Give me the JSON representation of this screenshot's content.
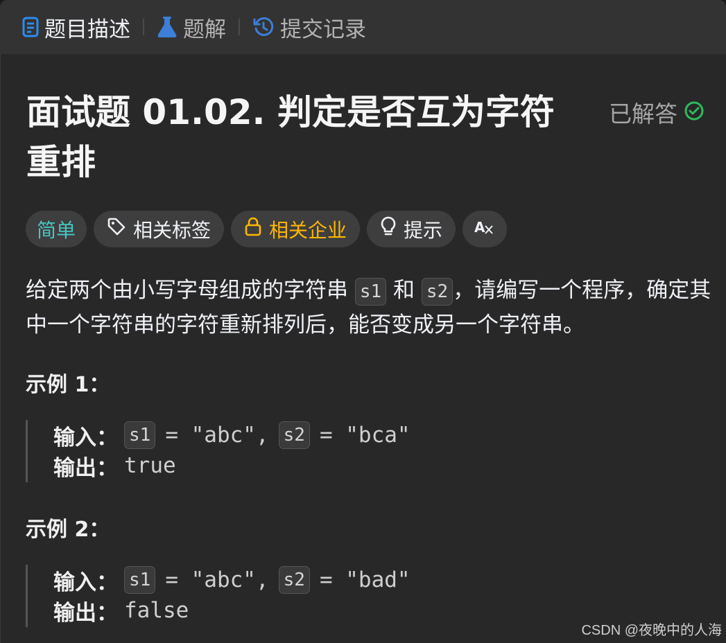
{
  "tabs": [
    {
      "label": "题目描述",
      "icon": "document-icon",
      "active": true
    },
    {
      "label": "题解",
      "icon": "flask-icon",
      "active": false
    },
    {
      "label": "提交记录",
      "icon": "history-icon",
      "active": false
    }
  ],
  "problem": {
    "title": "面试题 01.02. 判定是否互为字符重排",
    "status": "已解答",
    "status_icon": "check-circle-icon"
  },
  "tags": {
    "difficulty": "简单",
    "topics": "相关标签",
    "companies": "相关企业",
    "hint": "提示",
    "font_toggle": "Aあ"
  },
  "description": {
    "part1": "给定两个由小写字母组成的字符串",
    "var1": "s1",
    "part2": "和",
    "var2": "s2",
    "part3": "，请编写一个程序，确定其中一个字符串的字符重新排列后，能否变成另一个字符串。"
  },
  "examples": [
    {
      "title": "示例 1：",
      "input_label": "输入：",
      "var1": "s1",
      "val1": "= \"abc\",",
      "var2": "s2",
      "val2": "= \"bca\"",
      "output_label": "输出：",
      "output": "true"
    },
    {
      "title": "示例 2：",
      "input_label": "输入：",
      "var1": "s1",
      "val1": "= \"abc\",",
      "var2": "s2",
      "val2": "= \"bad\"",
      "output_label": "输出：",
      "output": "false"
    }
  ],
  "watermark": "CSDN @夜晚中的人海",
  "colors": {
    "easy": "#46c6c2",
    "company": "#ffb700",
    "solved_check": "#2cbb5d",
    "tab_icon_active": "#2d8cf0",
    "tab_icon_flask": "#3b7fd9"
  }
}
